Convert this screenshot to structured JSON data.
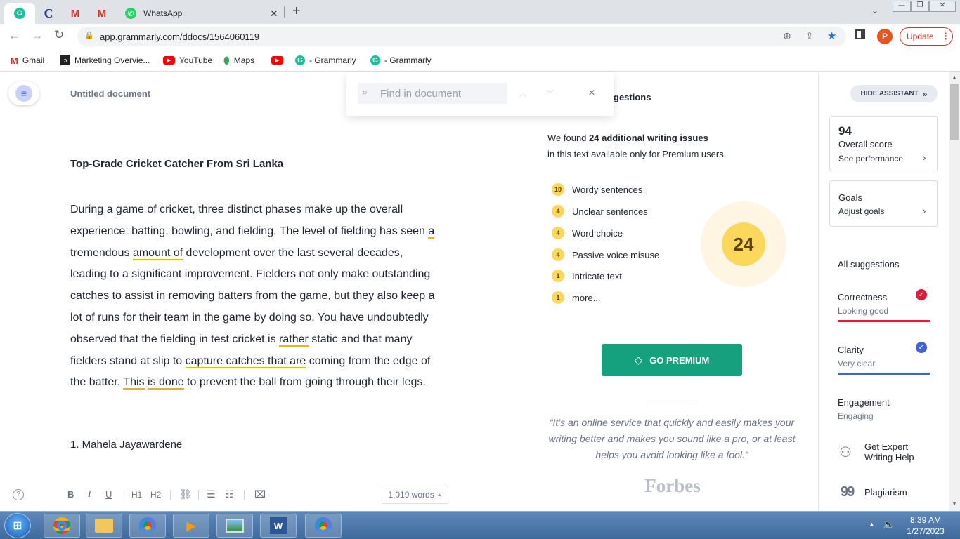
{
  "browser": {
    "tab_title": "WhatsApp",
    "url": "app.grammarly.com/ddocs/1564060119",
    "update_label": "Update",
    "profile_initial": "P"
  },
  "bookmarks": [
    {
      "label": "Gmail"
    },
    {
      "label": "Marketing Overvie..."
    },
    {
      "label": "YouTube"
    },
    {
      "label": "Maps"
    },
    {
      "label": "- Grammarly"
    },
    {
      "label": "- Grammarly"
    }
  ],
  "editor": {
    "doc_title": "Untitled document",
    "find_placeholder": "Find in document",
    "heading": "Top-Grade Cricket Catcher From Sri Lanka",
    "lines": [
      [
        "During a game of cricket, three distinct phases make up the overall"
      ],
      [
        "experience: batting, bowling, and fielding. The level of fielding has seen ",
        "a"
      ],
      [
        "tremendous ",
        "amount of",
        " development over the last several decades,"
      ],
      [
        "leading to a significant improvement. Fielders not only make outstanding"
      ],
      [
        "catches to assist in removing batters from the game, but they also keep a"
      ],
      [
        "lot of runs for their team in the game by doing so. You have undoubtedly"
      ],
      [
        "observed that the fielding in test cricket is ",
        "rather",
        " static and that many"
      ],
      [
        "fielders stand at slip to ",
        "capture catches that are",
        " coming from the edge of"
      ],
      [
        "the batter. ",
        "This",
        " ",
        "is done",
        " to prevent the ball from going through their legs."
      ]
    ],
    "list_item": "1. Mahela Jayawardene",
    "word_count": "1,019 words",
    "toolbar": [
      "B",
      "I",
      "U",
      "H1",
      "H2"
    ]
  },
  "premium": {
    "header_fragment": "gestions",
    "found_prefix": "We found ",
    "found_bold": "24 additional writing issues",
    "found_suffix": "in this text available only for Premium users.",
    "issues": [
      {
        "count": "10",
        "label": "Wordy sentences"
      },
      {
        "count": "4",
        "label": "Unclear sentences"
      },
      {
        "count": "4",
        "label": "Word choice"
      },
      {
        "count": "4",
        "label": "Passive voice misuse"
      },
      {
        "count": "1",
        "label": "Intricate text"
      },
      {
        "count": "1",
        "label": "more..."
      }
    ],
    "total": "24",
    "cta": "GO PREMIUM",
    "quote": "“It’s an online service that quickly and easily makes your writing better and makes you sound like a pro, or at least helps you avoid looking like a fool.”",
    "source": "Forbes"
  },
  "assistant": {
    "hide_label": "HIDE ASSISTANT",
    "score": "94",
    "score_label": "Overall score",
    "score_link": "See performance",
    "goals": "Goals",
    "goals_link": "Adjust goals",
    "all_suggestions": "All suggestions",
    "correctness": "Correctness",
    "correctness_status": "Looking good",
    "clarity": "Clarity",
    "clarity_status": "Very clear",
    "engagement": "Engagement",
    "engagement_status": "Engaging",
    "expert": "Get Expert Writing Help",
    "plagiarism": "Plagiarism",
    "colors": {
      "correctness": "#e31b3b",
      "clarity": "#3f62d8",
      "brand": "#15a07e",
      "badge": "#fbd75b"
    }
  },
  "taskbar": {
    "time": "8:39 AM",
    "date": "1/27/2023"
  }
}
